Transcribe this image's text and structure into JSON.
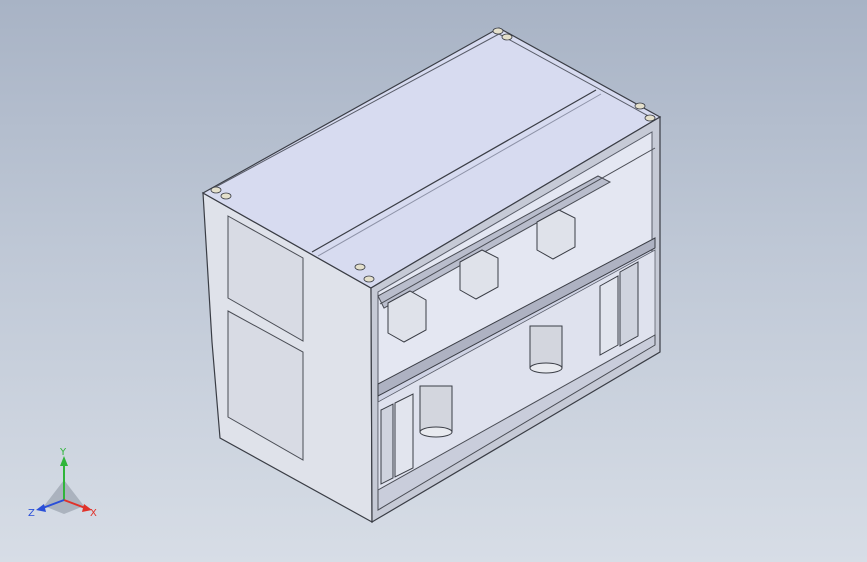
{
  "viewport": {
    "background_top": "#a8b3c5",
    "background_bottom": "#d7dde6",
    "model": "cabinet-assembly-isometric"
  },
  "triad": {
    "x_label": "X",
    "y_label": "Y",
    "z_label": "Z",
    "x_color": "#e0322a",
    "y_color": "#2fb53a",
    "z_color": "#2a4fd8"
  }
}
